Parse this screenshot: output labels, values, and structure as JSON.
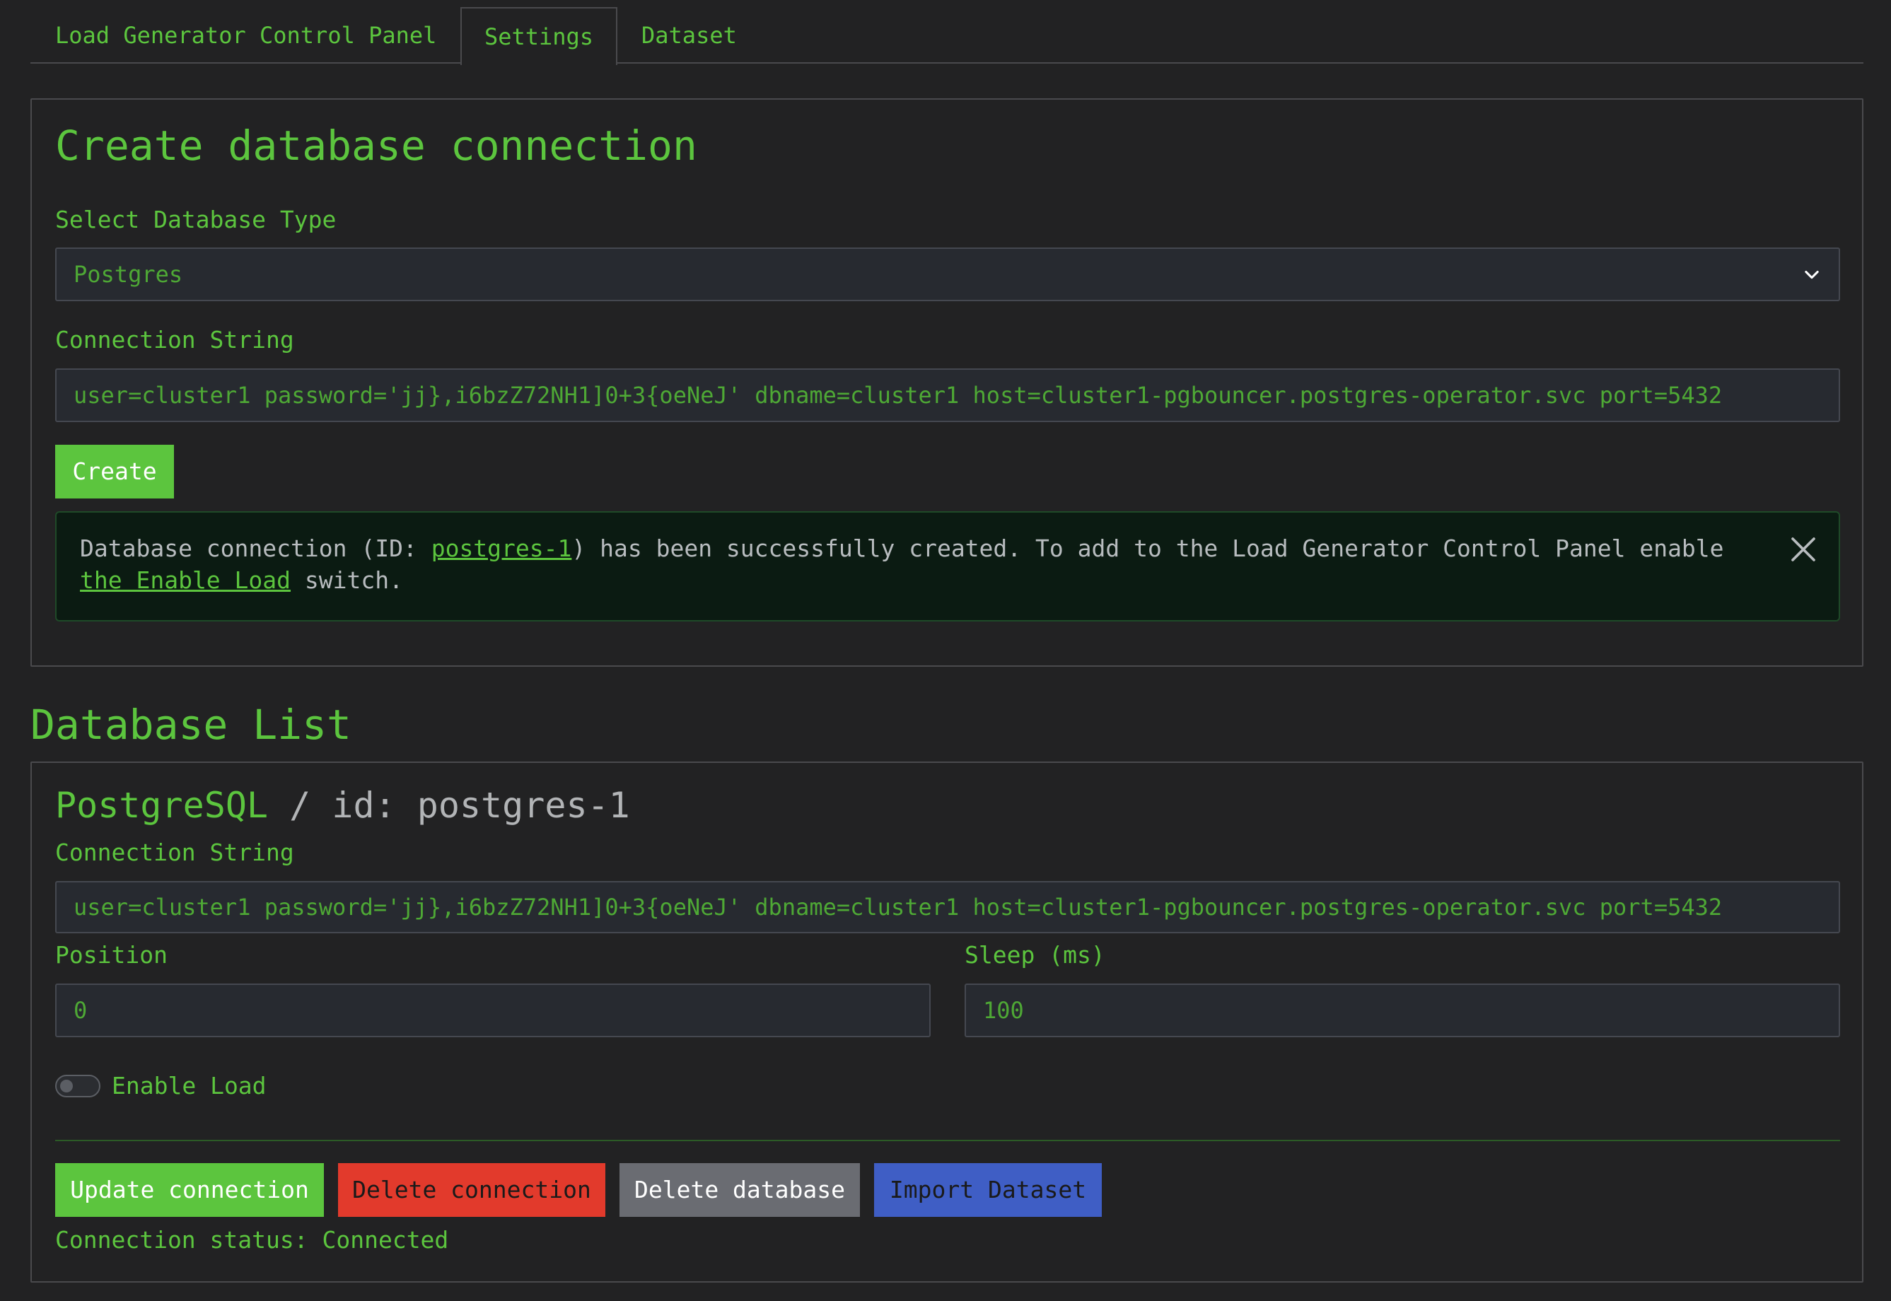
{
  "tabs": [
    {
      "label": "Load Generator Control Panel",
      "active": false
    },
    {
      "label": "Settings",
      "active": true
    },
    {
      "label": "Dataset",
      "active": false
    }
  ],
  "create": {
    "title": "Create database connection",
    "db_type_label": "Select Database Type",
    "db_type_value": "Postgres",
    "conn_label": "Connection String",
    "conn_value": "user=cluster1 password='jj},i6bzZ72NH1]0+3{oeNeJ' dbname=cluster1 host=cluster1-pgbouncer.postgres-operator.svc port=5432",
    "create_button": "Create",
    "alert": {
      "text_before": "Database connection (ID: ",
      "id_link": "postgres-1",
      "text_middle": ") has been successfully created. To add to the Load Generator Control Panel enable ",
      "enable_link": "the Enable Load",
      "text_after": " switch."
    }
  },
  "list": {
    "title": "Database List",
    "card": {
      "db_name": "PostgreSQL",
      "id_text": " / id: postgres-1",
      "conn_label": "Connection String",
      "conn_value": "user=cluster1 password='jj},i6bzZ72NH1]0+3{oeNeJ' dbname=cluster1 host=cluster1-pgbouncer.postgres-operator.svc port=5432",
      "position_label": "Position",
      "position_value": "0",
      "sleep_label": "Sleep (ms)",
      "sleep_value": "100",
      "enable_load_label": "Enable Load",
      "enable_load_on": false,
      "buttons": {
        "update": "Update connection",
        "delete_connection": "Delete connection",
        "delete_database": "Delete database",
        "import_dataset": "Import Dataset"
      },
      "status": "Connection status: Connected"
    }
  },
  "colors": {
    "accent": "#5cc53e",
    "background": "#222223",
    "danger": "#e23a2c",
    "secondary": "#6a6c72",
    "info": "#3f5ec5"
  },
  "icons": [
    "chevron-down-icon",
    "close-icon"
  ]
}
